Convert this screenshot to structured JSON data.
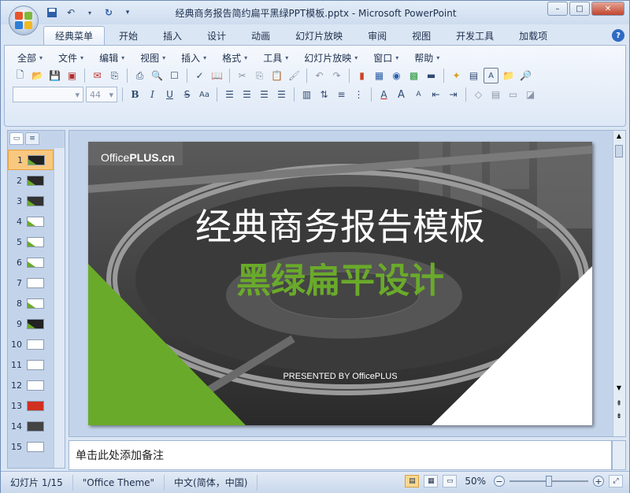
{
  "window": {
    "title": "经典商务报告简约扁平黑绿PPT模板.pptx - Microsoft PowerPoint",
    "controls": {
      "minimize": "–",
      "maximize": "□",
      "close": "✕"
    }
  },
  "qat": {
    "save_icon": "save-icon",
    "undo_icon": "undo-icon",
    "redo_icon": "redo-icon",
    "customize": "▾"
  },
  "ribbon_tabs": [
    "经典菜单",
    "开始",
    "插入",
    "设计",
    "动画",
    "幻灯片放映",
    "审阅",
    "视图",
    "开发工具",
    "加载项"
  ],
  "active_tab": "经典菜单",
  "help_label": "?",
  "classic_menus": [
    "全部",
    "文件",
    "编辑",
    "视图",
    "插入",
    "格式",
    "工具",
    "幻灯片放映",
    "窗口",
    "帮助"
  ],
  "font_size": "44",
  "slide_panel": {
    "thumbs": [
      "1",
      "2",
      "3",
      "4",
      "5",
      "6",
      "7",
      "8",
      "9",
      "10",
      "11",
      "12",
      "13",
      "14",
      "15"
    ],
    "selected": "1"
  },
  "slide": {
    "logo_left": "Office",
    "logo_right": "PLUS.cn",
    "title": "经典商务报告模板",
    "subtitle": "黑绿扁平设计",
    "presented": "PRESENTED BY OfficePLUS"
  },
  "notes_placeholder": "单击此处添加备注",
  "status": {
    "slide_counter": "幻灯片 1/15",
    "theme": "\"Office Theme\"",
    "language": "中文(简体，中国)",
    "zoom": "50%",
    "zoom_level": 0.5
  },
  "colors": {
    "accent_green": "#6aaa2a",
    "ribbon_blue": "#dbe6f4"
  }
}
